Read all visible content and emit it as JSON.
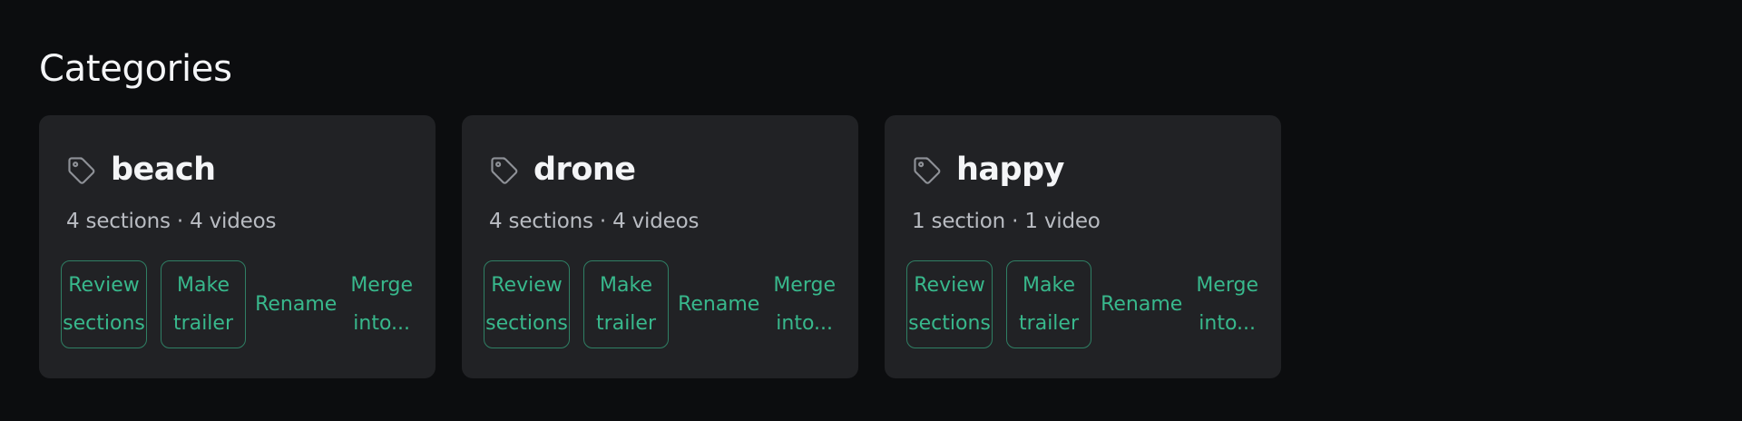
{
  "page": {
    "title": "Categories"
  },
  "icons": {
    "tag": "tag-icon"
  },
  "colors": {
    "background": "#0c0d0f",
    "card": "#212225",
    "accent": "#38b88c",
    "accent_border": "#2f7f64",
    "muted_text": "#b9bcc2"
  },
  "categories": [
    {
      "name": "beach",
      "meta": "4 sections · 4 videos",
      "actions": {
        "review": "Review\nsections",
        "trailer": "Make\ntrailer",
        "rename": "Rename",
        "merge": "Merge\ninto..."
      }
    },
    {
      "name": "drone",
      "meta": "4 sections · 4 videos",
      "actions": {
        "review": "Review\nsections",
        "trailer": "Make\ntrailer",
        "rename": "Rename",
        "merge": "Merge\ninto..."
      }
    },
    {
      "name": "happy",
      "meta": "1 section · 1 video",
      "actions": {
        "review": "Review\nsections",
        "trailer": "Make\ntrailer",
        "rename": "Rename",
        "merge": "Merge\ninto..."
      }
    }
  ]
}
